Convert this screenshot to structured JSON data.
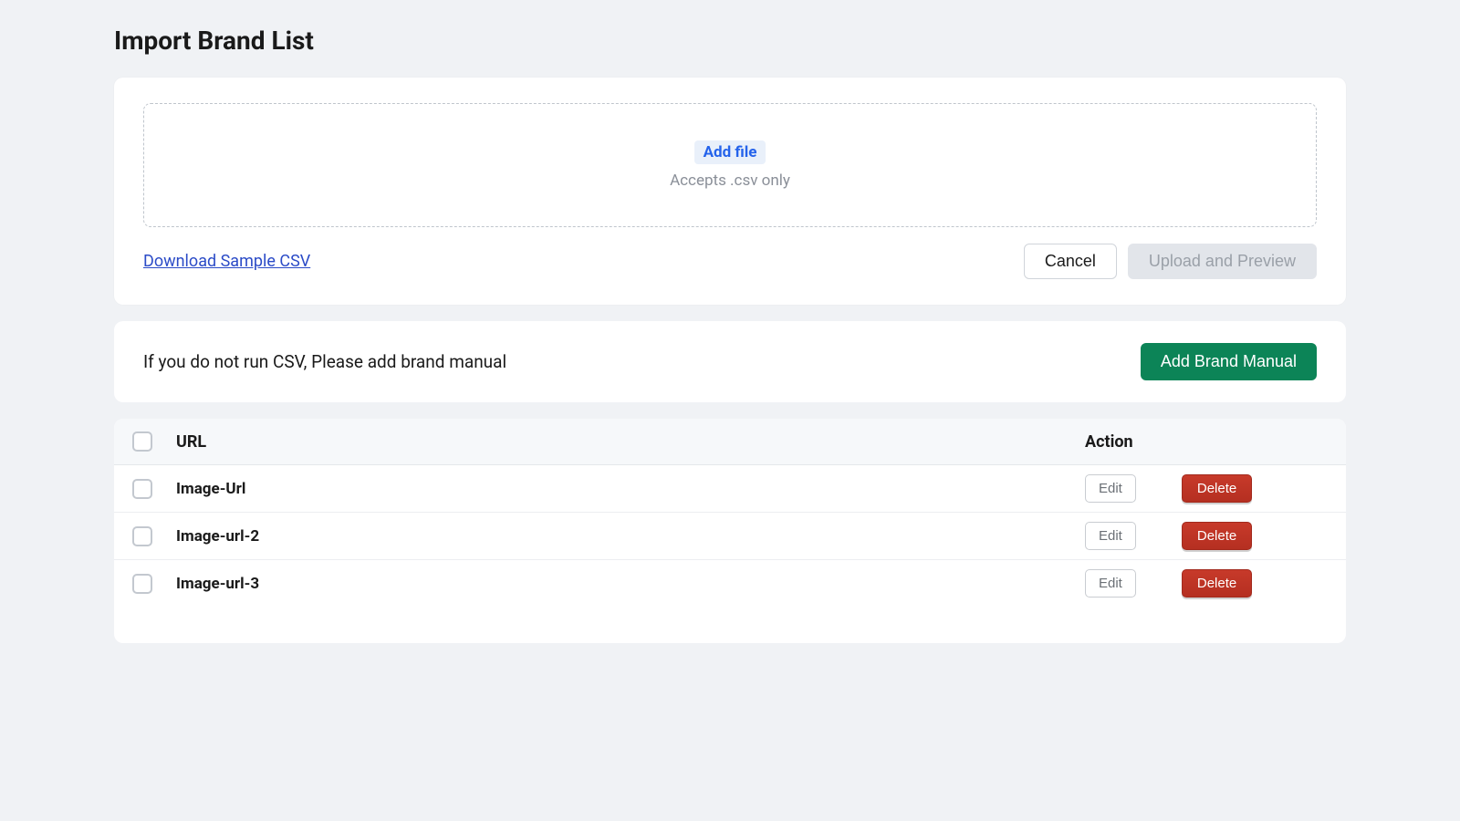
{
  "page": {
    "title": "Import Brand List"
  },
  "upload": {
    "add_file_label": "Add file",
    "accept_text": "Accepts .csv only",
    "download_link": "Download Sample CSV",
    "cancel_label": "Cancel",
    "upload_preview_label": "Upload and Preview"
  },
  "manual": {
    "info_text": "If you do not run CSV, Please add brand manual",
    "add_brand_label": "Add Brand Manual"
  },
  "table": {
    "header_url": "URL",
    "header_action": "Action",
    "edit_label": "Edit",
    "delete_label": "Delete",
    "rows": [
      {
        "url": "Image-Url"
      },
      {
        "url": "Image-url-2"
      },
      {
        "url": "Image-url-3"
      }
    ]
  }
}
